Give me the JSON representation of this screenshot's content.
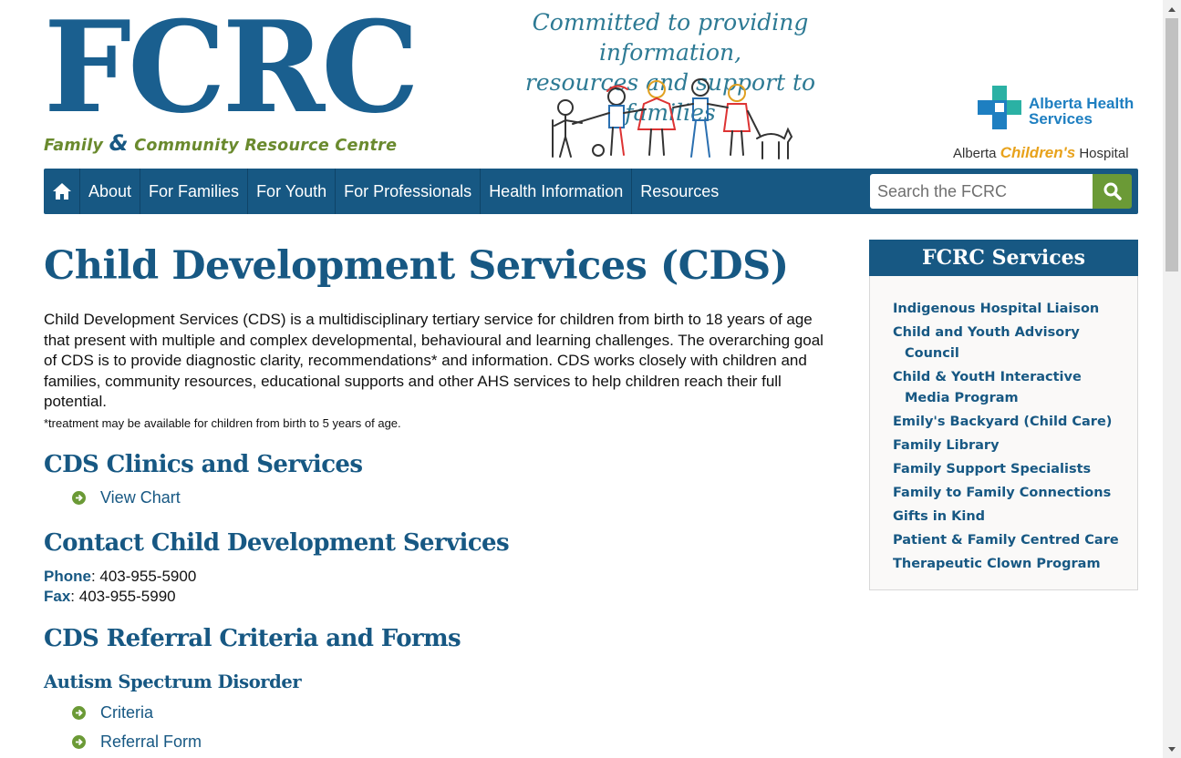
{
  "header": {
    "logo_main": "FCRC",
    "logo_sub_left": "Family",
    "logo_sub_amp": "&",
    "logo_sub_right": "Community Resource Centre",
    "tagline_line1": "Committed to providing information,",
    "tagline_line2": "resources and support to families",
    "ahs_line1": "Alberta Health",
    "ahs_line2": "Services",
    "ach_pre": "Alberta",
    "ach_mid": "Children's",
    "ach_post": "Hospital"
  },
  "nav": {
    "items": [
      "About",
      "For Families",
      "For Youth",
      "For Professionals",
      "Health Information",
      "Resources"
    ],
    "search_placeholder": "Search the FCRC"
  },
  "main": {
    "title": "Child Development Services (CDS)",
    "intro": "Child Development Services (CDS) is a multidisciplinary tertiary service for children from birth to 18 years of age that present with multiple and complex developmental, behavioural and learning challenges. The overarching goal of CDS is to provide diagnostic clarity, recommendations* and information. CDS works closely with children and families, community resources, educational supports and other AHS services to help children reach their full potential.",
    "note": "*treatment may be available for children from birth to 5 years of age.",
    "clinics_heading": "CDS Clinics and Services",
    "view_chart": "View Chart",
    "contact_heading": "Contact Child Development Services",
    "phone_label": "Phone",
    "phone_value": ": 403-955-5900",
    "fax_label": "Fax",
    "fax_value": ": 403-955-5990",
    "referral_heading": "CDS Referral Criteria and Forms",
    "autism_heading": "Autism Spectrum Disorder",
    "criteria": "Criteria",
    "referral_form": "Referral Form"
  },
  "sidebar": {
    "title": "FCRC Services",
    "items": [
      "Indigenous Hospital Liaison",
      "Child and Youth Advisory Council",
      "Child & YoutH Interactive Media Program",
      "Emily's Backyard (Child Care)",
      "Family Library",
      "Family Support Specialists",
      "Family to Family Connections",
      "Gifts in Kind",
      "Patient & Family Centred Care",
      "Therapeutic Clown Program"
    ]
  },
  "colors": {
    "brand_blue": "#175883",
    "accent_green": "#6b9a36",
    "link_blue": "#175883"
  }
}
